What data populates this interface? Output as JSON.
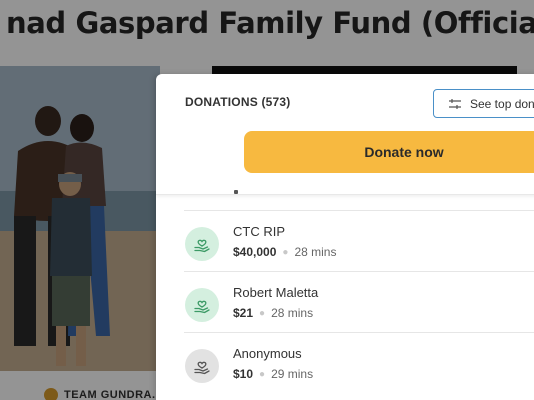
{
  "page": {
    "title": "nad Gaspard Family Fund (Official)",
    "team_label": "TEAM GUNDRA..."
  },
  "modal": {
    "heading": "DONATIONS (573)",
    "top_donations_label": "See top dona",
    "donate_label": "Donate now",
    "accent_color": "#f7b940"
  },
  "donations": [
    {
      "name": "CTC RIP",
      "amount": "$40,000",
      "time": "28 mins",
      "avatar": "heart-hand-icon",
      "avatar_color": "green"
    },
    {
      "name": "Robert Maletta",
      "amount": "$21",
      "time": "28 mins",
      "avatar": "heart-hand-icon",
      "avatar_color": "green"
    },
    {
      "name": "Anonymous",
      "amount": "$10",
      "time": "29 mins",
      "avatar": "heart-hand-icon",
      "avatar_color": "grey"
    }
  ]
}
